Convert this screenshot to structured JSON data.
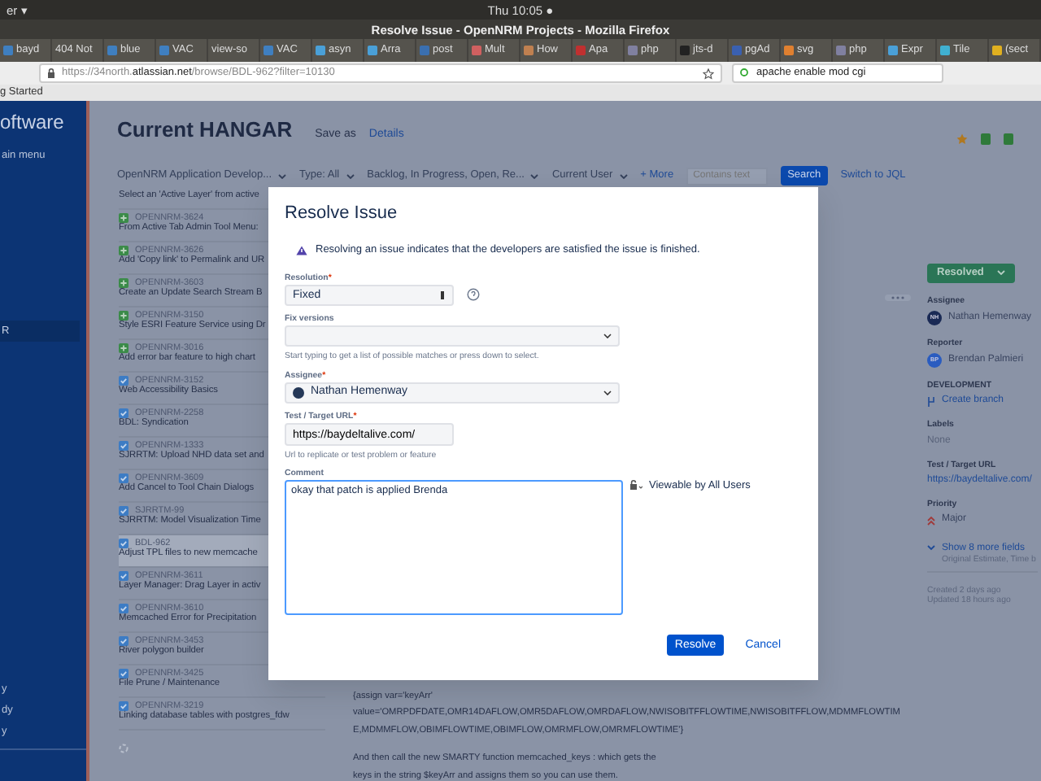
{
  "os_bar": {
    "menu": "er ▾",
    "clock": "Thu 10:05 ●"
  },
  "window": {
    "title": "Resolve Issue - OpenNRM Projects - Mozilla Firefox"
  },
  "tabs": [
    {
      "label": "bayd",
      "selected": false,
      "color": "#3f7fc0"
    },
    {
      "label": "404 Not",
      "selected": false
    },
    {
      "label": "blue",
      "selected": false,
      "color": "#3f7fc0"
    },
    {
      "label": "VAC",
      "selected": false,
      "color": "#3f7fc0"
    },
    {
      "label": "view-so",
      "selected": false
    },
    {
      "label": "VAC",
      "selected": false,
      "color": "#3f7fc0"
    },
    {
      "label": "asyn",
      "selected": false,
      "color": "#4aa0d8"
    },
    {
      "label": "Arra",
      "selected": false,
      "color": "#4aa0d8"
    },
    {
      "label": "post",
      "selected": false,
      "color": "#3a6fb0"
    },
    {
      "label": "Mult",
      "selected": false,
      "color": "#d06060"
    },
    {
      "label": "How",
      "selected": false,
      "color": "#c08050"
    },
    {
      "label": "Apa",
      "selected": false,
      "color": "#c03030"
    },
    {
      "label": "php",
      "selected": false,
      "color": "#8080a0"
    },
    {
      "label": "jts-d",
      "selected": false,
      "color": "#222222"
    },
    {
      "label": "pgAd",
      "selected": false,
      "color": "#3a60b0"
    },
    {
      "label": "svg",
      "selected": false,
      "color": "#e08030"
    },
    {
      "label": "php",
      "selected": false,
      "color": "#8080a0"
    },
    {
      "label": "Expr",
      "selected": false,
      "color": "#4aa0d8"
    },
    {
      "label": "Tile",
      "selected": false,
      "color": "#40b0d0"
    },
    {
      "label": "(sect",
      "selected": false,
      "color": "#e0b020"
    }
  ],
  "address_bar": {
    "url": "https://34north.**atlassian.net**/browse/BDL-962?filter=10130"
  },
  "search_bar": {
    "value": "apache enable mod cgi"
  },
  "bookmarks": [
    "g Started"
  ],
  "sidebar": {
    "brand": "oftware",
    "menu": "ain menu",
    "items": [
      {
        "label": "R",
        "selected": true
      },
      {
        "label": "y",
        "selected": false
      },
      {
        "label": "dy",
        "selected": false
      },
      {
        "label": "y",
        "selected": false
      }
    ]
  },
  "header": {
    "title": "Current HANGAR",
    "save_as": "Save as",
    "details": "Details"
  },
  "filters": {
    "project": "OpenNRM Application Develop...",
    "type": "Type: All",
    "status": "Backlog, In Progress, Open, Re...",
    "assignee": "Current User",
    "more": "+ More",
    "search_placeholder": "Contains text",
    "search_button": "Search",
    "switch": "Switch to JQL"
  },
  "issues": [
    {
      "title": "Select an 'Active Layer' from active",
      "selected": false
    },
    {
      "key": "OPENNRM-3624",
      "kind": "story",
      "title": "From Active Tab Admin Tool Menu:",
      "selected": false
    },
    {
      "key": "OPENNRM-3626",
      "kind": "story",
      "title": "Add 'Copy link' to Permalink and UR",
      "selected": false
    },
    {
      "key": "OPENNRM-3603",
      "kind": "story",
      "title": "Create an Update Search Stream B",
      "selected": false
    },
    {
      "key": "OPENNRM-3150",
      "kind": "story",
      "title": "Style ESRI Feature Service using Dr",
      "selected": false
    },
    {
      "key": "OPENNRM-3016",
      "kind": "story",
      "title": "Add error bar feature to high chart",
      "selected": false
    },
    {
      "key": "OPENNRM-3152",
      "kind": "task",
      "title": "Web Accessibility Basics",
      "selected": false
    },
    {
      "key": "OPENNRM-2258",
      "kind": "task",
      "title": "BDL: Syndication",
      "selected": false
    },
    {
      "key": "OPENNRM-1333",
      "kind": "task",
      "title": "SJRRTM: Upload NHD data set and",
      "selected": false
    },
    {
      "key": "OPENNRM-3609",
      "kind": "task",
      "title": "Add Cancel to Tool Chain Dialogs",
      "selected": false
    },
    {
      "key": "SJRRTM-99",
      "kind": "task",
      "title": "SJRRTM: Model Visualization Time",
      "selected": false
    },
    {
      "key": "BDL-962",
      "kind": "task",
      "title": "Adjust TPL files to new memcache",
      "selected": true
    },
    {
      "key": "OPENNRM-3611",
      "kind": "task",
      "title": "Layer Manager: Drag Layer in activ",
      "selected": false
    },
    {
      "key": "OPENNRM-3610",
      "kind": "task",
      "title": "Memcached Error for Precipitation",
      "selected": false
    },
    {
      "key": "OPENNRM-3453",
      "kind": "task",
      "title": "River polygon builder",
      "selected": false
    },
    {
      "key": "OPENNRM-3425",
      "kind": "task",
      "title": "File Prune / Maintenance",
      "selected": false
    },
    {
      "key": "OPENNRM-3219",
      "kind": "task",
      "title": "Linking database tables with postgres_fdw",
      "selected": false
    }
  ],
  "description": [
    "{assign var='keyArr'",
    "value='OMRPDFDATE,OMR14DAFLOW,OMR5DAFLOW,OMRDAFLOW,NWISOBITFFLOWTIME,NWISOBITFFLOW,MDMMFLOWTIM",
    "E,MDMMFLOW,OBIMFLOWTIME,OBIMFLOW,OMRMFLOW,OMRMFLOWTIME'}",
    "And then call the new SMARTY function memcached_keys : which gets the",
    "keys in the string $keyArr and assigns them so you can use them."
  ],
  "details_panel": {
    "status": "Resolved",
    "fields": [
      {
        "label": "Assignee",
        "kind": "person",
        "initials": "NH",
        "value": "Nathan Hemenway",
        "color": "#1a2a55"
      },
      {
        "label": "Reporter",
        "kind": "person",
        "initials": "BP",
        "value": "Brendan Palmieri",
        "color": "#2a5cc0"
      },
      {
        "label": "DEVELOPMENT",
        "kind": "branch",
        "value": "Create branch"
      },
      {
        "label": "Labels",
        "kind": "plain",
        "value": "None"
      },
      {
        "label": "Test / Target URL",
        "kind": "link",
        "value": "https://baydeltalive.com/"
      },
      {
        "label": "Priority",
        "kind": "priority",
        "value": "Major"
      }
    ],
    "more_fields": "Show 8 more fields",
    "more_hint": "Original Estimate, Time b",
    "created": "Created 2 days ago",
    "updated": "Updated 18 hours ago"
  },
  "dialog": {
    "title": "Resolve Issue",
    "warning": "Resolving an issue indicates that the developers are satisfied the issue is finished.",
    "resolution": {
      "label": "Resolution",
      "required_mark": "*",
      "value": "Fixed"
    },
    "fix_versions": {
      "label": "Fix versions",
      "hint": "Start typing to get a list of possible matches or press down to select."
    },
    "assignee": {
      "label": "Assignee",
      "required_mark": "*",
      "value": "Nathan Hemenway"
    },
    "target_url": {
      "label": "Test / Target URL",
      "required_mark": "*",
      "value": "https://baydeltalive.com/",
      "hint": "Url to replicate or test problem or feature"
    },
    "comment": {
      "label": "Comment",
      "value": "okay that patch is applied Brenda",
      "visibility": "Viewable by All Users"
    },
    "buttons": [
      {
        "label": "Resolve",
        "kind": "primary"
      },
      {
        "label": "Cancel",
        "kind": "link"
      }
    ]
  }
}
